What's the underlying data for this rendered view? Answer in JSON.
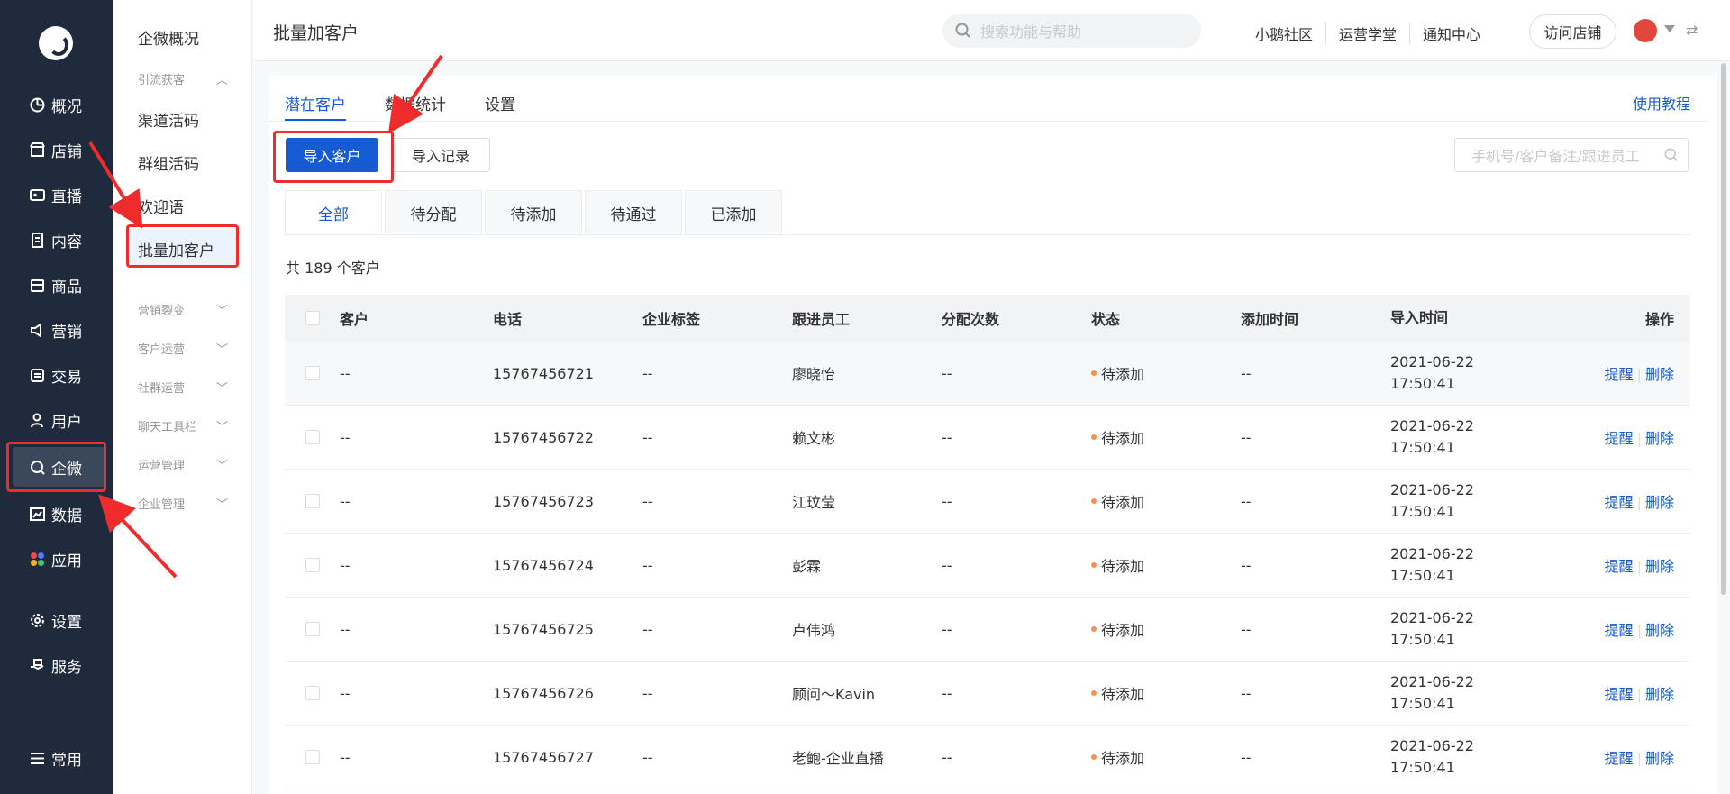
{
  "nav1": {
    "items": [
      {
        "label": "概况",
        "icon": "overview-icon"
      },
      {
        "label": "店铺",
        "icon": "store-icon"
      },
      {
        "label": "直播",
        "icon": "live-icon"
      },
      {
        "label": "内容",
        "icon": "content-icon"
      },
      {
        "label": "商品",
        "icon": "goods-icon"
      },
      {
        "label": "营销",
        "icon": "marketing-icon"
      },
      {
        "label": "交易",
        "icon": "trade-icon"
      },
      {
        "label": "用户",
        "icon": "user-icon"
      },
      {
        "label": "企微",
        "icon": "wecom-icon"
      },
      {
        "label": "数据",
        "icon": "data-icon"
      },
      {
        "label": "应用",
        "icon": "apps-icon"
      },
      {
        "label": "设置",
        "icon": "gear-icon"
      },
      {
        "label": "服务",
        "icon": "service-icon"
      },
      {
        "label": "常用",
        "icon": "menu-icon"
      }
    ],
    "active": "企微"
  },
  "nav2": {
    "overview": "企微概况",
    "group_lead": "引流获客",
    "channel_code": "渠道活码",
    "group_code": "群组活码",
    "welcome": "欢迎语",
    "batch_add": "批量加客户",
    "groups": [
      "营销裂变",
      "客户运营",
      "社群运营",
      "聊天工具栏",
      "运营管理",
      "企业管理"
    ]
  },
  "topbar": {
    "title": "批量加客户",
    "search_placeholder": "搜索功能与帮助",
    "links": [
      "小鹅社区",
      "运营学堂",
      "通知中心"
    ],
    "visit_store": "访问店铺"
  },
  "main": {
    "tabs": [
      "潜在客户",
      "数据统计",
      "设置"
    ],
    "active_tab": "潜在客户",
    "help": "使用教程",
    "import_btn": "导入客户",
    "records_btn": "导入记录",
    "filter_placeholder": "手机号/客户备注/跟进员工",
    "subtabs": [
      "全部",
      "待分配",
      "待添加",
      "待通过",
      "已添加"
    ],
    "active_subtab": "全部",
    "total": "共 189 个客户"
  },
  "table": {
    "headers": [
      "客户",
      "电话",
      "企业标签",
      "跟进员工",
      "分配次数",
      "状态",
      "添加时间",
      "导入时间",
      "操作"
    ],
    "rows": [
      {
        "customer": "--",
        "phone": "15767456721",
        "tag": "--",
        "staff": "廖晓怡",
        "count": "--",
        "status": "待添加",
        "added": "--",
        "date": "2021-06-22",
        "time": "17:50:41",
        "remind": "提醒",
        "delete": "删除"
      },
      {
        "customer": "--",
        "phone": "15767456722",
        "tag": "--",
        "staff": "赖文彬",
        "count": "--",
        "status": "待添加",
        "added": "--",
        "date": "2021-06-22",
        "time": "17:50:41",
        "remind": "提醒",
        "delete": "删除"
      },
      {
        "customer": "--",
        "phone": "15767456723",
        "tag": "--",
        "staff": "江玟莹",
        "count": "--",
        "status": "待添加",
        "added": "--",
        "date": "2021-06-22",
        "time": "17:50:41",
        "remind": "提醒",
        "delete": "删除"
      },
      {
        "customer": "--",
        "phone": "15767456724",
        "tag": "--",
        "staff": "彭霖",
        "count": "--",
        "status": "待添加",
        "added": "--",
        "date": "2021-06-22",
        "time": "17:50:41",
        "remind": "提醒",
        "delete": "删除"
      },
      {
        "customer": "--",
        "phone": "15767456725",
        "tag": "--",
        "staff": "卢伟鸿",
        "count": "--",
        "status": "待添加",
        "added": "--",
        "date": "2021-06-22",
        "time": "17:50:41",
        "remind": "提醒",
        "delete": "删除"
      },
      {
        "customer": "--",
        "phone": "15767456726",
        "tag": "--",
        "staff": "顾问～Kavin",
        "count": "--",
        "status": "待添加",
        "added": "--",
        "date": "2021-06-22",
        "time": "17:50:41",
        "remind": "提醒",
        "delete": "删除"
      },
      {
        "customer": "--",
        "phone": "15767456727",
        "tag": "--",
        "staff": "老鲍-企业直播",
        "count": "--",
        "status": "待添加",
        "added": "--",
        "date": "2021-06-22",
        "time": "17:50:41",
        "remind": "提醒",
        "delete": "删除"
      }
    ]
  },
  "colors": {
    "sidebar_bg": "#1f2a3c",
    "accent": "#155bd4",
    "status_dot": "#f1924e",
    "annotation": "#ef2b2b"
  }
}
